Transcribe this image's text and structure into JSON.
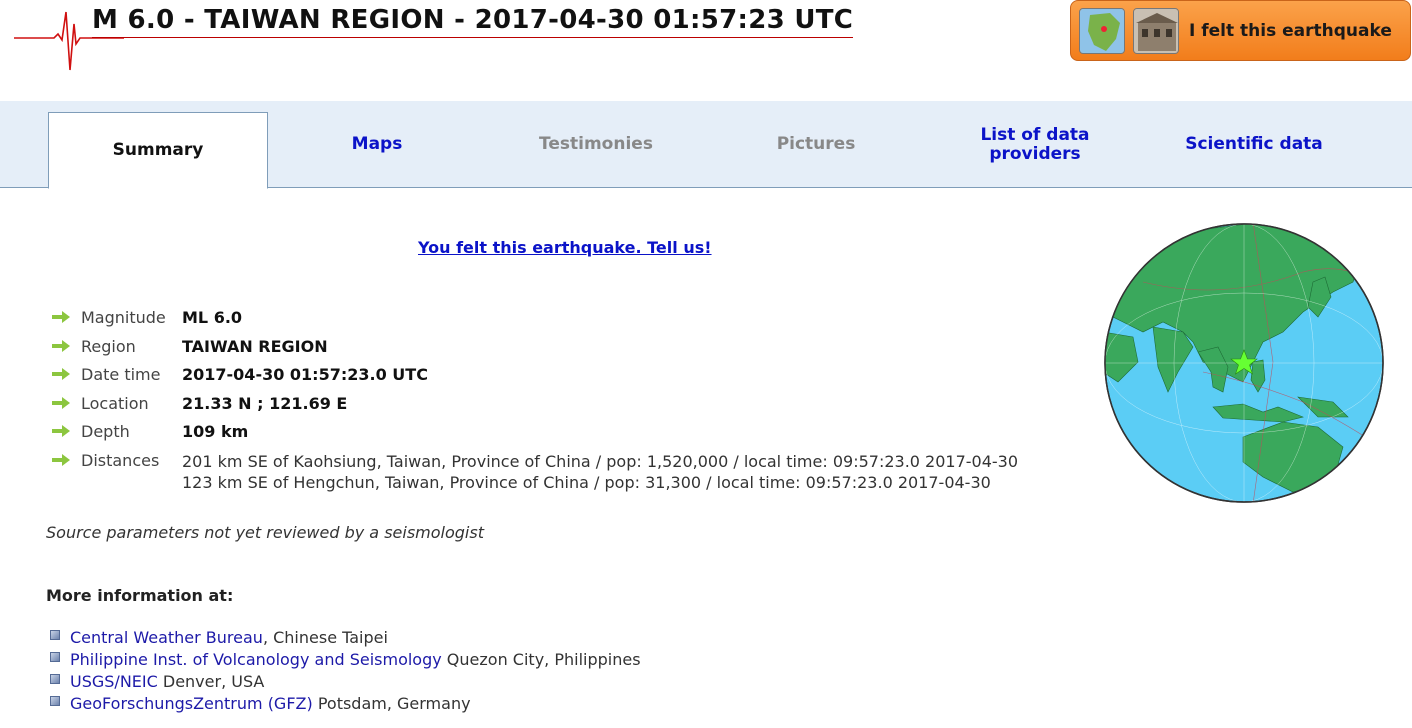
{
  "header": {
    "title": "M 6.0 - TAIWAN REGION - 2017-04-30 01:57:23 UTC",
    "felt_button_label": "I felt this earthquake"
  },
  "tabs": [
    {
      "label": "Summary",
      "state": "active"
    },
    {
      "label": "Maps",
      "state": "link"
    },
    {
      "label": "Testimonies",
      "state": "disabled"
    },
    {
      "label": "Pictures",
      "state": "disabled"
    },
    {
      "label": "List of data providers",
      "state": "link"
    },
    {
      "label": "Scientific data",
      "state": "link"
    }
  ],
  "felt_link": "You felt this earthquake. Tell us!",
  "details": {
    "magnitude": {
      "label": "Magnitude",
      "value": "ML 6.0"
    },
    "region": {
      "label": "Region",
      "value": "TAIWAN REGION"
    },
    "datetime": {
      "label": "Date time",
      "value": "2017-04-30 01:57:23.0 UTC"
    },
    "location": {
      "label": "Location",
      "value": "21.33 N ; 121.69 E"
    },
    "depth": {
      "label": "Depth",
      "value": "109 km"
    },
    "distances": {
      "label": "Distances",
      "lines": [
        "201 km SE of Kaohsiung, Taiwan, Province of China / pop: 1,520,000 / local time: 09:57:23.0 2017-04-30",
        "123 km SE of Hengchun, Taiwan, Province of China / pop: 31,300 / local time: 09:57:23.0 2017-04-30"
      ]
    }
  },
  "source_note": "Source parameters not yet reviewed by a seismologist",
  "more_info": {
    "title": "More information at:",
    "items": [
      {
        "name": "Central Weather Bureau",
        "location": ", Chinese Taipei"
      },
      {
        "name": "Philippine Inst. of Volcanology and Seismology",
        "location": " Quezon City, Philippines"
      },
      {
        "name": "USGS/NEIC",
        "location": " Denver, USA"
      },
      {
        "name": "GeoForschungsZentrum (GFZ)",
        "location": " Potsdam, Germany"
      }
    ]
  },
  "colors": {
    "link": "#0b13c8",
    "tab_bar": "#e5eef8",
    "button_orange": "#f27d1b",
    "ocean": "#5bcdf5",
    "land": "#3aa85c",
    "epicenter": "#66ff33"
  },
  "icons": {
    "logo": "seismogram-logo",
    "arrow": "green-arrow-icon",
    "bullet": "square-bullet-icon"
  }
}
